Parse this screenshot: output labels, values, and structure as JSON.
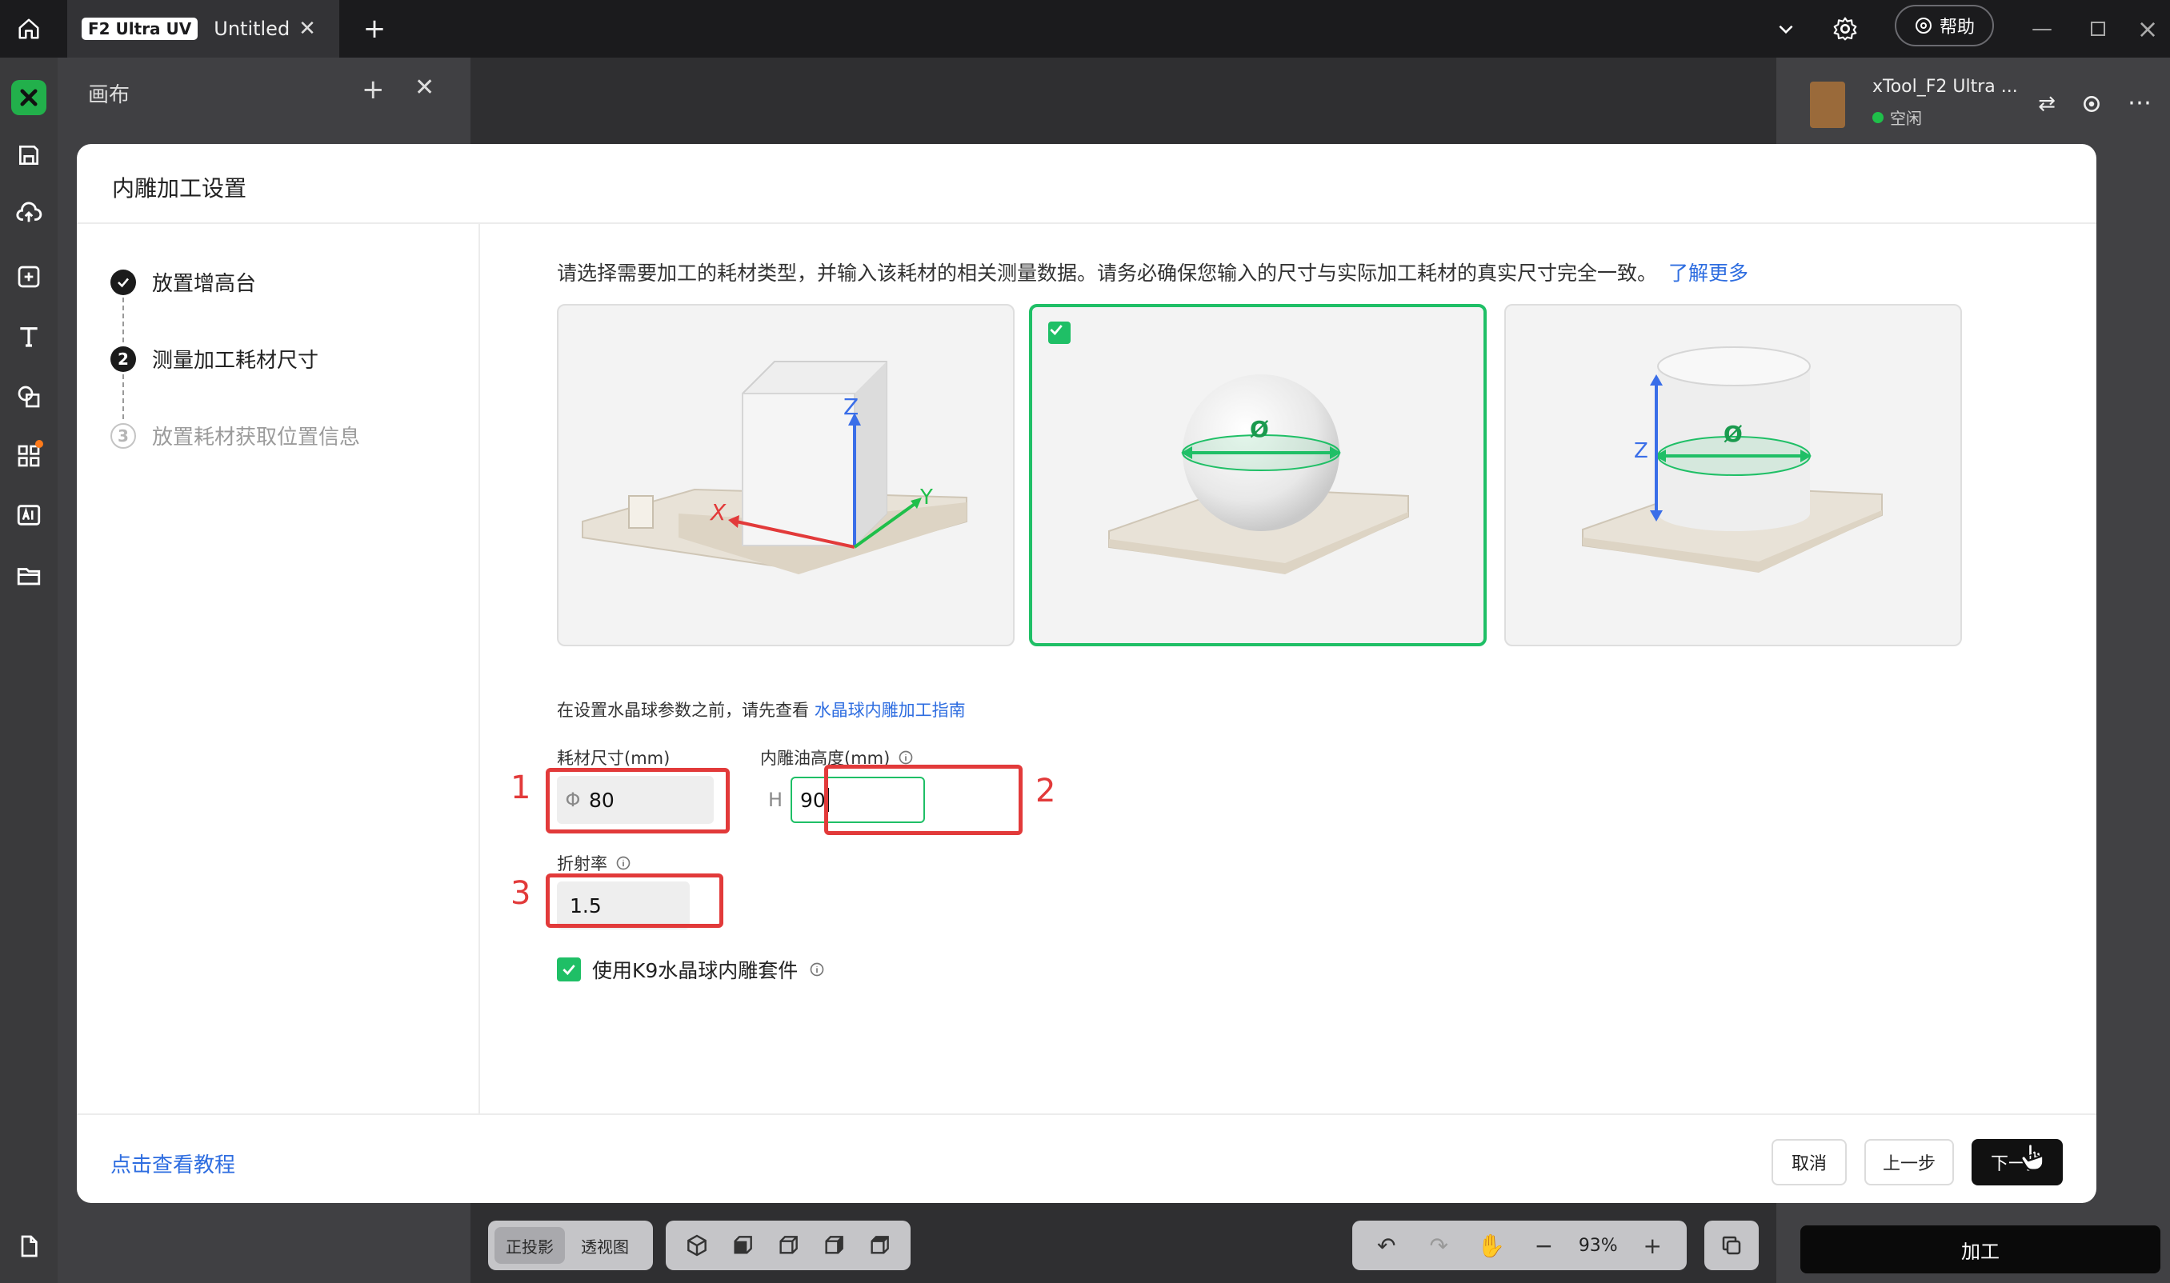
{
  "titlebar": {
    "tab_badge": "F2 Ultra UV",
    "tab_title": "Untitled",
    "tab_close": "✕",
    "tab_add": "+",
    "help_label": "帮助"
  },
  "canvas_panel": {
    "title": "画布",
    "add": "+",
    "close": "✕"
  },
  "device": {
    "name": "xTool_F2 Ultra ...",
    "status": "空闲",
    "status_color": "#1fbf4a"
  },
  "toolbar": {
    "view_modes": [
      "正投影",
      "透视图"
    ],
    "active_view": "正投影",
    "zoom": "93%",
    "process_label": "加工"
  },
  "modal": {
    "title": "内雕加工设置",
    "steps": [
      {
        "label": "放置增高台",
        "state": "done"
      },
      {
        "label": "测量加工耗材尺寸",
        "state": "current",
        "num": "2"
      },
      {
        "label": "放置耗材获取位置信息",
        "state": "pending",
        "num": "3"
      }
    ],
    "instruction": "请选择需要加工的耗材类型，并输入该耗材的相关测量数据。请务必确保您输入的尺寸与实际加工耗材的真实尺寸完全一致。",
    "learn_more": "了解更多",
    "material_cards": [
      {
        "name": "cube",
        "selected": false,
        "axis_labels": {
          "x": "X",
          "y": "Y",
          "z": "Z"
        }
      },
      {
        "name": "sphere",
        "selected": true,
        "axis_labels": {
          "d": "Ø"
        }
      },
      {
        "name": "cylinder",
        "selected": false,
        "axis_labels": {
          "z": "Z",
          "d": "Ø"
        }
      }
    ],
    "guide_prefix": "在设置水晶球参数之前，请先查看",
    "guide_link": "水晶球内雕加工指南",
    "fields": {
      "size": {
        "label": "耗材尺寸(mm)",
        "prefix": "Φ",
        "value": "80"
      },
      "oil_height": {
        "label": "内雕油高度(mm)",
        "prefix": "H",
        "value": "90"
      },
      "refraction": {
        "label": "折射率",
        "value": "1.5"
      }
    },
    "annotations": [
      "1",
      "2",
      "3"
    ],
    "annotation_color": "#e23a3a",
    "k9_label": "使用K9水晶球内雕套件",
    "k9_checked": true,
    "footer": {
      "tutorial": "点击查看教程",
      "cancel": "取消",
      "prev": "上一步",
      "next": "下一步"
    },
    "accent": "#1fbf66",
    "link_color": "#2e6de0"
  }
}
